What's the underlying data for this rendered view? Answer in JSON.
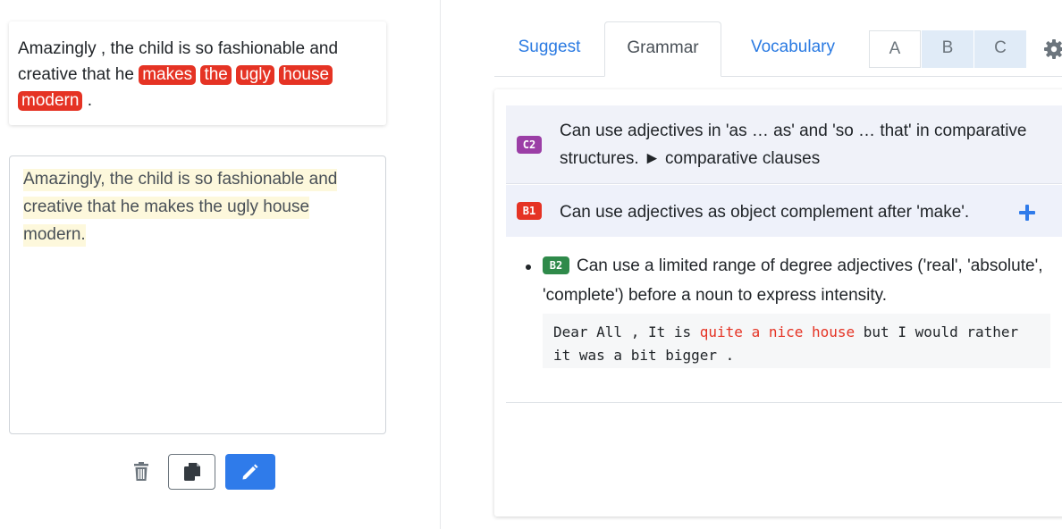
{
  "result": {
    "prefix": "Amazingly , the child is so fashionable and creative that he ",
    "highlighted": [
      "makes",
      "the",
      "ugly",
      "house",
      "modern"
    ],
    "suffix": " ."
  },
  "editor": {
    "text": "Amazingly, the child is so fashionable and creative that he makes the ugly house modern."
  },
  "tabs": [
    {
      "label": "Suggest"
    },
    {
      "label": "Grammar"
    },
    {
      "label": "Vocabulary"
    }
  ],
  "level_buttons": [
    "A",
    "B",
    "C"
  ],
  "rules": [
    {
      "level": "C2",
      "text": "Can use adjectives in 'as … as' and 'so … that' in comparative structures. ► comparative clauses"
    },
    {
      "level": "B1",
      "text": "Can use adjectives as object complement after 'make'."
    }
  ],
  "detail": {
    "level": "B2",
    "text": "Can use a limited range of degree adjectives ('real', 'absolute', 'complete') before a noun to express intensity.",
    "example": {
      "before": "Dear All , It is ",
      "highlight": "quite a nice house",
      "after": " but I would rather it was a bit bigger ."
    }
  },
  "colors": {
    "accent": "#2f7bea",
    "highlight": "#e53324",
    "c2_badge": "#9b3ea6",
    "b1_badge": "#e53324",
    "b2_badge": "#2f8a4a"
  }
}
